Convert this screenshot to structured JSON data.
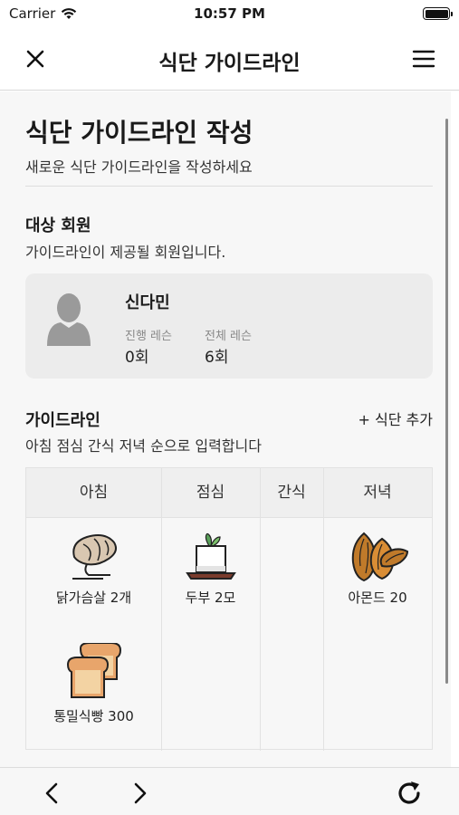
{
  "status_bar": {
    "carrier": "Carrier",
    "time": "10:57 PM",
    "battery_level": 1.0
  },
  "nav": {
    "title": "식단 가이드라인",
    "close_icon": "close-icon",
    "menu_icon": "hamburger-menu-icon"
  },
  "page": {
    "title": "식단 가이드라인 작성",
    "subtitle": "새로운 식단 가이드라인을 작성하세요"
  },
  "member_section": {
    "title": "대상 회원",
    "description": "가이드라인이 제공될 회원입니다.",
    "member": {
      "name": "신다민",
      "progress_label": "진행 레슨",
      "progress_value": "0회",
      "total_label": "전체 레슨",
      "total_value": "6회"
    }
  },
  "guideline_section": {
    "title": "가이드라인",
    "description": "아침 점심 간식 저녁 순으로 입력합니다",
    "add_button": "+ 식단 추가",
    "columns": [
      "아침",
      "점심",
      "간식",
      "저녁"
    ],
    "foods": [
      {
        "column": "아침",
        "label": "닭가슴살 2개",
        "icon": "chicken-breast-icon"
      },
      {
        "column": "아침",
        "label": "통밀식빵 300",
        "icon": "bread-icon"
      },
      {
        "column": "점심",
        "label": "두부 2모",
        "icon": "tofu-icon"
      },
      {
        "column": "저녁",
        "label": "아몬드 20",
        "icon": "almond-icon"
      }
    ]
  },
  "toolbar": {
    "back_icon": "chevron-left-icon",
    "forward_icon": "chevron-right-icon",
    "refresh_icon": "refresh-icon"
  }
}
